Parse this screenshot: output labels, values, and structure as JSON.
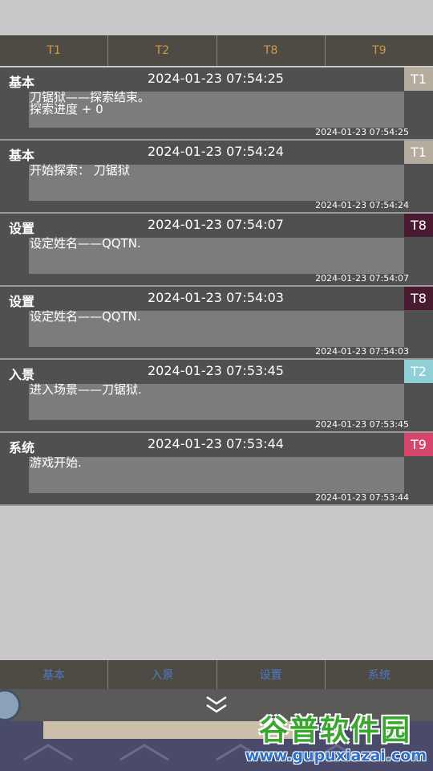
{
  "top_tabs": [
    "T1",
    "T2",
    "T8",
    "T9"
  ],
  "log_entries": [
    {
      "category": "基本",
      "time": "2024-01-23 07:54:25",
      "tag": "T1",
      "tag_color": "#b5aca0",
      "message": "刀锯狱——探索结束。\n探索进度 + 0",
      "stamp": "2024-01-23 07:54:25"
    },
    {
      "category": "基本",
      "time": "2024-01-23 07:54:24",
      "tag": "T1",
      "tag_color": "#b5aca0",
      "message": "开始探索：  刀锯狱",
      "stamp": "2024-01-23 07:54:24"
    },
    {
      "category": "设置",
      "time": "2024-01-23 07:54:07",
      "tag": "T8",
      "tag_color": "#4a1a30",
      "message": "设定姓名——QQTN.",
      "stamp": "2024-01-23 07:54:07"
    },
    {
      "category": "设置",
      "time": "2024-01-23 07:54:03",
      "tag": "T8",
      "tag_color": "#4a1a30",
      "message": "设定姓名——QQTN.",
      "stamp": "2024-01-23 07:54:03"
    },
    {
      "category": "入景",
      "time": "2024-01-23 07:53:45",
      "tag": "T2",
      "tag_color": "#8fcfd6",
      "message": "进入场景——刀锯狱.",
      "stamp": "2024-01-23 07:53:45"
    },
    {
      "category": "系统",
      "time": "2024-01-23 07:53:44",
      "tag": "T9",
      "tag_color": "#d6456a",
      "message": "游戏开始.",
      "stamp": "2024-01-23 07:53:44"
    }
  ],
  "bottom_tabs": [
    "基本",
    "入景",
    "设置",
    "系统"
  ],
  "icons": {
    "collapse": "chevron-double-down-icon",
    "avatar": "avatar"
  },
  "watermark": {
    "name": "谷普软件园",
    "url": "www.gupuxiazai.com"
  }
}
